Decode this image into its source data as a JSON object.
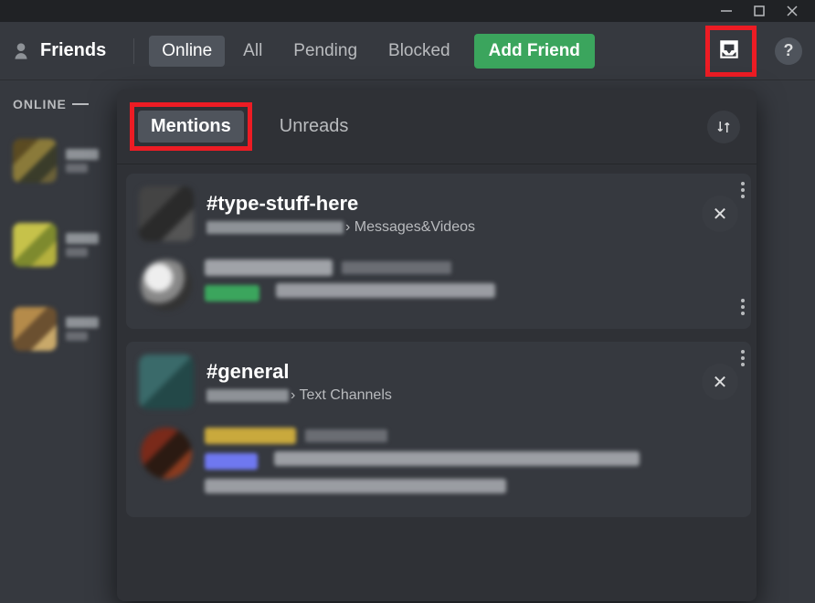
{
  "window": {
    "title": ""
  },
  "header": {
    "friends_label": "Friends",
    "tabs": {
      "online": "Online",
      "all": "All",
      "pending": "Pending",
      "blocked": "Blocked"
    },
    "add_friend": "Add Friend",
    "help_glyph": "?"
  },
  "sidebar": {
    "online_header": "ONLINE"
  },
  "inbox": {
    "tabs": {
      "mentions": "Mentions",
      "unreads": "Unreads"
    },
    "selected_tab": "mentions",
    "items": [
      {
        "channel": "#type-stuff-here",
        "path_suffix": "› Messages&Videos"
      },
      {
        "channel": "#general",
        "path_suffix": "› Text Channels"
      }
    ],
    "close_glyph": "✕"
  },
  "colors": {
    "accent_green": "#3ba55d",
    "highlight_red": "#ed1c24",
    "bg_main": "#36393f",
    "bg_panel": "#2f3136"
  }
}
